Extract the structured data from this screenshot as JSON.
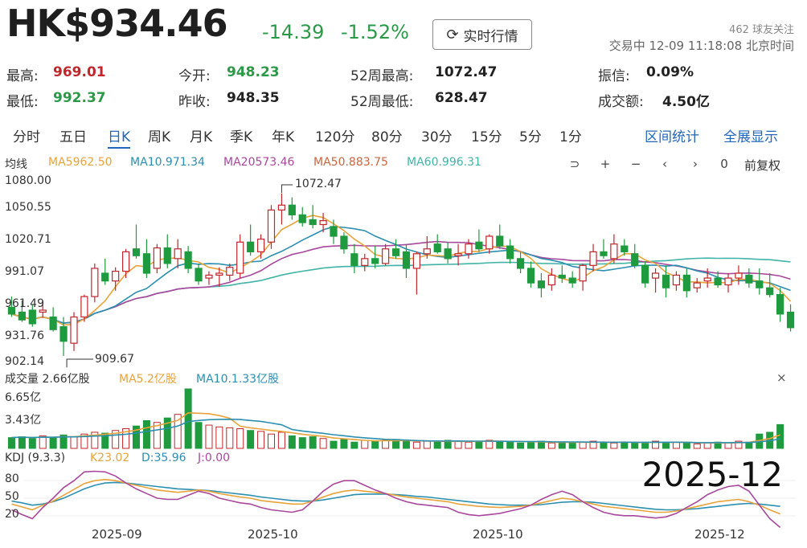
{
  "header": {
    "price": "HK$934.46",
    "change": "-14.39",
    "change_pct": "-1.52%",
    "realtime_button": "实时行情",
    "followers": "462 球友关注",
    "status": "交易中 12-09 11:18:08 北京时间"
  },
  "stats": [
    {
      "label": "最高:",
      "value": "969.01"
    },
    {
      "label": "今开:",
      "value": "948.23"
    },
    {
      "label": "52周最高:",
      "value": "1072.47"
    },
    {
      "label": "振信:",
      "value": "0.09%"
    },
    {
      "label": "最低:",
      "value": "992.37"
    },
    {
      "label": "昨收:",
      "value": "948.35"
    },
    {
      "label": "52周最低:",
      "value": "628.47"
    },
    {
      "label": "成交额:",
      "value": "4.50亿"
    }
  ],
  "tabs": [
    "分时",
    "五日",
    "日K",
    "周K",
    "月K",
    "季K",
    "年K",
    "120分",
    "80分",
    "30分",
    "15分",
    "5分",
    "1分"
  ],
  "active_tab": "日K",
  "tab_actions": [
    "区间统计",
    "全展显示"
  ],
  "ma_legend": [
    {
      "label": "均线",
      "color": "#333333"
    },
    {
      "label": "MA5962.50",
      "color": "#e8a33a"
    },
    {
      "label": "MA10.971.34",
      "color": "#2b8fb0"
    },
    {
      "label": "MA20573.46",
      "color": "#a9479c"
    },
    {
      "label": "MA50.883.75",
      "color": "#c9653f"
    },
    {
      "label": "MA60.996.31",
      "color": "#40b4a6"
    }
  ],
  "chart_controls": {
    "zoom_out": "⊃",
    "plus": "+",
    "minus": "−",
    "prev": "‹",
    "next": "›",
    "reset": "0",
    "fq": "前复权"
  },
  "y_axis": [
    "1080.00",
    "1050.55",
    "1020.71",
    "991.07",
    "961.49",
    "931.76",
    "902.14"
  ],
  "annotations": {
    "high": "1072.47",
    "low": "909.67"
  },
  "volume": {
    "title": "成交量 2.66亿股",
    "ma5": "MA5.2亿股",
    "ma10": "MA10.1.33亿股",
    "axis": [
      "6.65亿",
      "3.43亿"
    ],
    "close": "×"
  },
  "kdj": {
    "title": "KDJ (9.3.3)",
    "k": "K23.02",
    "d": "D:35.96",
    "j": "J:0.00",
    "axis": [
      "80",
      "50",
      "20"
    ]
  },
  "x_dates": [
    "2025-09",
    "2025-10",
    "2025-10",
    "2025-12"
  ],
  "overlay_text": "2025-12",
  "colors": {
    "up": "#c2252b",
    "down": "#2a9a48",
    "candle_up": "#c2252b",
    "candle_down": "#1f9a3f",
    "ma5": "#e8a33a",
    "ma10": "#2b8fb0",
    "ma20": "#a9479c",
    "ma60": "#40b4a6",
    "accent": "#2266bb"
  },
  "chart_data": {
    "type": "candlestick",
    "y_range": [
      895,
      1085
    ],
    "candles": [
      {
        "o": 955,
        "h": 966,
        "l": 945,
        "c": 948
      },
      {
        "o": 950,
        "h": 962,
        "l": 940,
        "c": 942
      },
      {
        "o": 952,
        "h": 958,
        "l": 935,
        "c": 938
      },
      {
        "o": 950,
        "h": 962,
        "l": 944,
        "c": 952
      },
      {
        "o": 945,
        "h": 955,
        "l": 930,
        "c": 932
      },
      {
        "o": 935,
        "h": 945,
        "l": 905,
        "c": 920
      },
      {
        "o": 918,
        "h": 950,
        "l": 910,
        "c": 945
      },
      {
        "o": 945,
        "h": 968,
        "l": 940,
        "c": 966
      },
      {
        "o": 966,
        "h": 1000,
        "l": 960,
        "c": 995
      },
      {
        "o": 990,
        "h": 1005,
        "l": 978,
        "c": 982
      },
      {
        "o": 982,
        "h": 996,
        "l": 972,
        "c": 992
      },
      {
        "o": 992,
        "h": 1015,
        "l": 985,
        "c": 1012
      },
      {
        "o": 1015,
        "h": 1040,
        "l": 1005,
        "c": 1008
      },
      {
        "o": 1010,
        "h": 1025,
        "l": 985,
        "c": 990
      },
      {
        "o": 995,
        "h": 1020,
        "l": 990,
        "c": 1016
      },
      {
        "o": 1016,
        "h": 1030,
        "l": 995,
        "c": 1000
      },
      {
        "o": 1005,
        "h": 1025,
        "l": 995,
        "c": 1015
      },
      {
        "o": 1012,
        "h": 1018,
        "l": 990,
        "c": 995
      },
      {
        "o": 995,
        "h": 1000,
        "l": 978,
        "c": 982
      },
      {
        "o": 985,
        "h": 992,
        "l": 978,
        "c": 988
      },
      {
        "o": 988,
        "h": 996,
        "l": 976,
        "c": 990
      },
      {
        "o": 988,
        "h": 1000,
        "l": 982,
        "c": 996
      },
      {
        "o": 990,
        "h": 1030,
        "l": 985,
        "c": 1022
      },
      {
        "o": 1022,
        "h": 1040,
        "l": 1008,
        "c": 1012
      },
      {
        "o": 1012,
        "h": 1030,
        "l": 1005,
        "c": 1025
      },
      {
        "o": 1022,
        "h": 1060,
        "l": 1015,
        "c": 1055
      },
      {
        "o": 1055,
        "h": 1072,
        "l": 1040,
        "c": 1060
      },
      {
        "o": 1060,
        "h": 1068,
        "l": 1045,
        "c": 1050
      },
      {
        "o": 1050,
        "h": 1058,
        "l": 1038,
        "c": 1042
      },
      {
        "o": 1045,
        "h": 1060,
        "l": 1036,
        "c": 1040
      },
      {
        "o": 1040,
        "h": 1052,
        "l": 1032,
        "c": 1044
      },
      {
        "o": 1038,
        "h": 1045,
        "l": 1020,
        "c": 1028
      },
      {
        "o": 1028,
        "h": 1032,
        "l": 1010,
        "c": 1015
      },
      {
        "o": 1010,
        "h": 1020,
        "l": 990,
        "c": 998
      },
      {
        "o": 998,
        "h": 1010,
        "l": 992,
        "c": 1005
      },
      {
        "o": 1005,
        "h": 1018,
        "l": 995,
        "c": 1000
      },
      {
        "o": 1000,
        "h": 1020,
        "l": 998,
        "c": 1015
      },
      {
        "o": 1015,
        "h": 1025,
        "l": 1005,
        "c": 1008
      },
      {
        "o": 1012,
        "h": 1020,
        "l": 985,
        "c": 995
      },
      {
        "o": 995,
        "h": 1012,
        "l": 968,
        "c": 1010
      },
      {
        "o": 1010,
        "h": 1028,
        "l": 1005,
        "c": 1015
      },
      {
        "o": 1020,
        "h": 1030,
        "l": 1010,
        "c": 1012
      },
      {
        "o": 1015,
        "h": 1022,
        "l": 1000,
        "c": 1005
      },
      {
        "o": 1008,
        "h": 1020,
        "l": 998,
        "c": 1010
      },
      {
        "o": 1010,
        "h": 1025,
        "l": 1005,
        "c": 1020
      },
      {
        "o": 1022,
        "h": 1035,
        "l": 1012,
        "c": 1015
      },
      {
        "o": 1015,
        "h": 1030,
        "l": 1010,
        "c": 1028
      },
      {
        "o": 1028,
        "h": 1040,
        "l": 1015,
        "c": 1018
      },
      {
        "o": 1018,
        "h": 1025,
        "l": 1000,
        "c": 1005
      },
      {
        "o": 1005,
        "h": 1012,
        "l": 990,
        "c": 995
      },
      {
        "o": 995,
        "h": 1002,
        "l": 975,
        "c": 980
      },
      {
        "o": 982,
        "h": 990,
        "l": 965,
        "c": 975
      },
      {
        "o": 978,
        "h": 995,
        "l": 972,
        "c": 988
      },
      {
        "o": 988,
        "h": 998,
        "l": 980,
        "c": 985
      },
      {
        "o": 985,
        "h": 992,
        "l": 975,
        "c": 980
      },
      {
        "o": 982,
        "h": 1000,
        "l": 972,
        "c": 998
      },
      {
        "o": 998,
        "h": 1020,
        "l": 992,
        "c": 1012
      },
      {
        "o": 1012,
        "h": 1025,
        "l": 1005,
        "c": 1008
      },
      {
        "o": 1005,
        "h": 1030,
        "l": 1000,
        "c": 1020
      },
      {
        "o": 1018,
        "h": 1025,
        "l": 1008,
        "c": 1012
      },
      {
        "o": 1010,
        "h": 1020,
        "l": 995,
        "c": 998
      },
      {
        "o": 998,
        "h": 1002,
        "l": 975,
        "c": 980
      },
      {
        "o": 985,
        "h": 995,
        "l": 970,
        "c": 990
      },
      {
        "o": 988,
        "h": 998,
        "l": 965,
        "c": 975
      },
      {
        "o": 978,
        "h": 992,
        "l": 972,
        "c": 988
      },
      {
        "o": 988,
        "h": 995,
        "l": 965,
        "c": 972
      },
      {
        "o": 975,
        "h": 985,
        "l": 970,
        "c": 980
      },
      {
        "o": 982,
        "h": 995,
        "l": 975,
        "c": 985
      },
      {
        "o": 985,
        "h": 992,
        "l": 975,
        "c": 978
      },
      {
        "o": 978,
        "h": 990,
        "l": 970,
        "c": 985
      },
      {
        "o": 985,
        "h": 998,
        "l": 978,
        "c": 990
      },
      {
        "o": 988,
        "h": 995,
        "l": 975,
        "c": 980
      },
      {
        "o": 982,
        "h": 995,
        "l": 968,
        "c": 975
      },
      {
        "o": 975,
        "h": 990,
        "l": 965,
        "c": 968
      },
      {
        "o": 968,
        "h": 975,
        "l": 940,
        "c": 948
      },
      {
        "o": 950,
        "h": 958,
        "l": 930,
        "c": 934
      }
    ],
    "volumes": [
      1.2,
      1.3,
      1.1,
      1.4,
      1.2,
      1.5,
      1.3,
      1.6,
      1.8,
      1.7,
      2.0,
      2.2,
      2.5,
      3.1,
      2.9,
      3.4,
      3.8,
      6.65,
      2.9,
      2.6,
      2.4,
      2.3,
      2.2,
      2.0,
      1.9,
      1.6,
      1.8,
      1.4,
      1.2,
      1.3,
      1.1,
      0.8,
      1.0,
      0.7,
      0.9,
      0.8,
      0.9,
      1.0,
      0.8,
      0.7,
      0.8,
      0.7,
      0.9,
      0.8,
      0.7,
      0.8,
      0.9,
      0.8,
      0.7,
      0.6,
      0.7,
      0.8,
      0.6,
      0.7,
      0.6,
      0.7,
      0.8,
      0.7,
      0.6,
      0.7,
      0.6,
      0.7,
      0.8,
      0.6,
      0.7,
      0.6,
      0.5,
      0.6,
      0.7,
      0.6,
      0.8,
      0.7,
      1.6,
      1.8,
      2.66
    ],
    "kdj": {
      "k": [
        40,
        35,
        30,
        38,
        45,
        55,
        65,
        75,
        80,
        82,
        80,
        76,
        72,
        68,
        64,
        62,
        60,
        62,
        64,
        62,
        58,
        55,
        52,
        50,
        46,
        44,
        42,
        40,
        40,
        45,
        52,
        58,
        62,
        64,
        62,
        60,
        58,
        55,
        52,
        50,
        48,
        46,
        44,
        40,
        38,
        36,
        35,
        34,
        35,
        36,
        38,
        42,
        46,
        50,
        48,
        44,
        40,
        36,
        34,
        32,
        30,
        28,
        26,
        26,
        28,
        32,
        36,
        40,
        44,
        46,
        48,
        44,
        38,
        30,
        23
      ],
      "d": [
        45,
        42,
        38,
        40,
        44,
        50,
        58,
        66,
        72,
        76,
        77,
        76,
        74,
        72,
        70,
        68,
        66,
        65,
        64,
        63,
        61,
        59,
        57,
        55,
        52,
        50,
        48,
        46,
        45,
        45,
        47,
        50,
        53,
        56,
        57,
        57,
        57,
        56,
        55,
        53,
        52,
        50,
        48,
        46,
        44,
        42,
        40,
        39,
        38,
        38,
        38,
        39,
        41,
        43,
        44,
        44,
        43,
        41,
        39,
        37,
        35,
        33,
        31,
        30,
        30,
        31,
        32,
        34,
        36,
        38,
        40,
        41,
        40,
        38,
        36
      ],
      "j": [
        30,
        22,
        15,
        34,
        50,
        68,
        80,
        95,
        96,
        95,
        88,
        76,
        66,
        58,
        50,
        48,
        48,
        55,
        62,
        58,
        50,
        46,
        42,
        40,
        34,
        30,
        28,
        26,
        30,
        45,
        62,
        74,
        80,
        80,
        72,
        64,
        58,
        50,
        44,
        40,
        38,
        36,
        34,
        26,
        22,
        20,
        22,
        24,
        28,
        32,
        38,
        48,
        56,
        62,
        56,
        44,
        34,
        26,
        22,
        20,
        20,
        18,
        16,
        18,
        24,
        34,
        44,
        56,
        64,
        70,
        72,
        62,
        38,
        15,
        0
      ]
    }
  }
}
